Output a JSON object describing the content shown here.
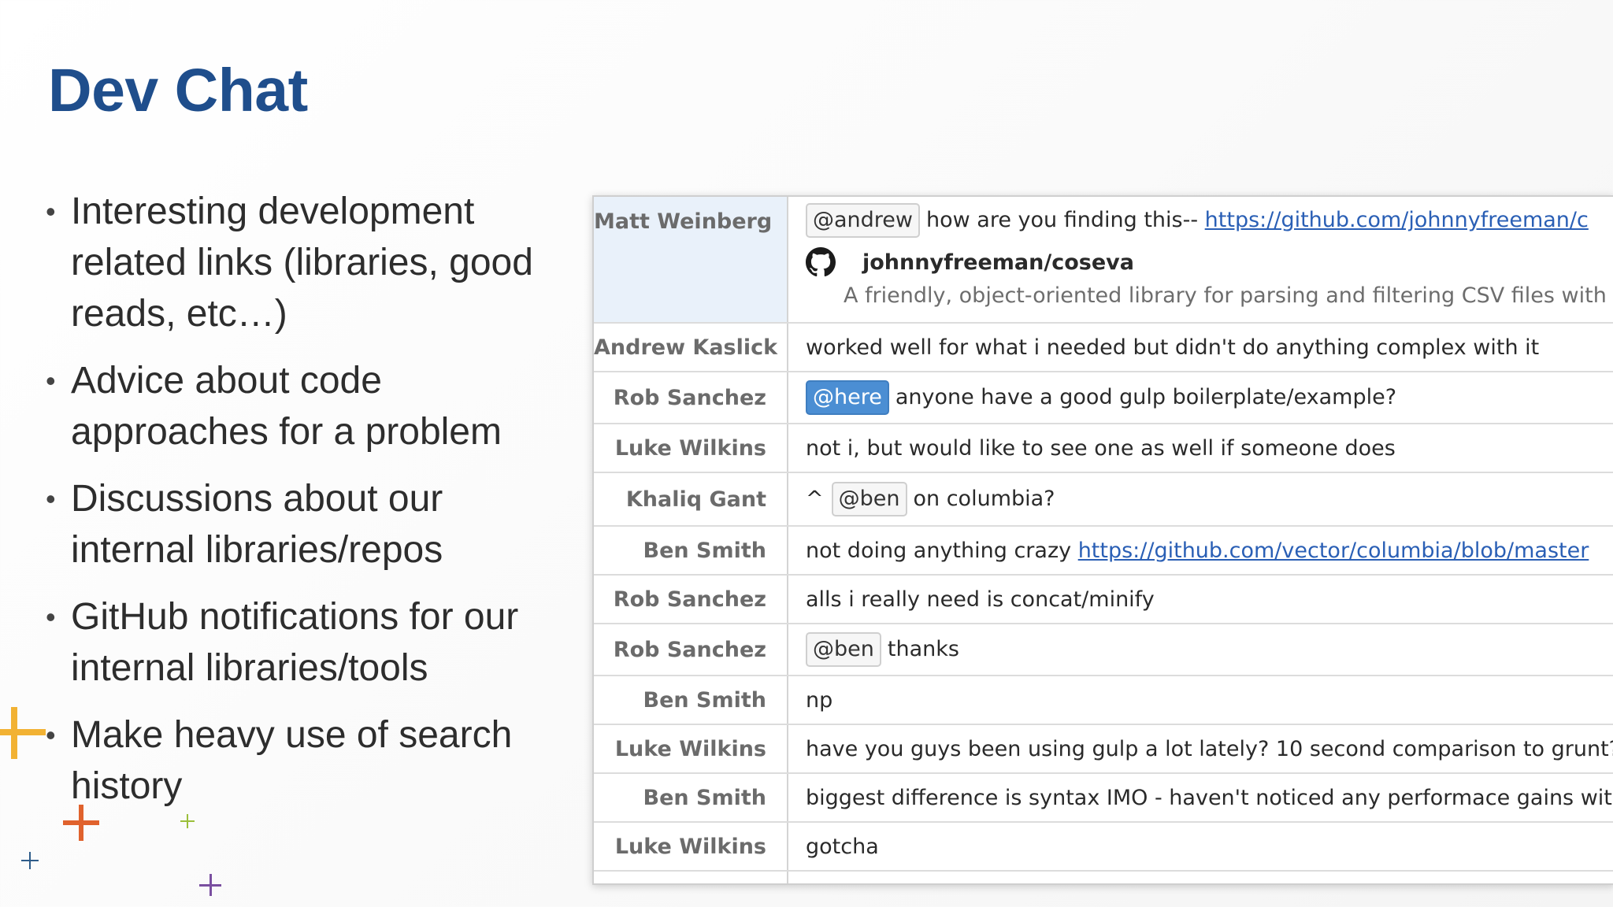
{
  "slide": {
    "title": "Dev Chat",
    "title_color": "#1f4e8c",
    "bullets": [
      "Interesting development related links (libraries, good reads, etc…)",
      "Advice about code approaches for a problem",
      "Discussions about our internal libraries/repos",
      "GitHub notifications for our internal libraries/tools",
      "Make heavy use of search history"
    ]
  },
  "decorations": {
    "plus_colors": [
      "#f2b233",
      "#e0622d",
      "#9bbf3b",
      "#2e5c8a",
      "#7a4fa0"
    ]
  },
  "chat": {
    "attachment": {
      "icon": "github-icon",
      "title": "johnnyfreeman/coseva",
      "description": "A friendly, object-oriented library for parsing and filtering CSV files with"
    },
    "rows": [
      {
        "author": "Matt Weinberg",
        "mention": "@andrew",
        "text": "how are you finding this-- ",
        "link": "https://github.com/johnnyfreeman/c"
      },
      {
        "author": "Andrew Kaslick",
        "text": "worked well for what i needed but didn't do anything complex with it"
      },
      {
        "author": "Rob Sanchez",
        "mention": "@here",
        "text": "anyone have a good gulp boilerplate/example?"
      },
      {
        "author": "Luke Wilkins",
        "text": "not i, but would like to see one as well if someone does"
      },
      {
        "author": "Khaliq Gant",
        "prefix": "^",
        "mention": "@ben",
        "text": "on columbia?"
      },
      {
        "author": "Ben Smith",
        "text": "not doing anything crazy ",
        "link": "https://github.com/vector/columbia/blob/master"
      },
      {
        "author": "Rob Sanchez",
        "text": "alls i really need is concat/minify"
      },
      {
        "author": "Rob Sanchez",
        "mention": "@ben",
        "text": "thanks"
      },
      {
        "author": "Ben Smith",
        "text": "np"
      },
      {
        "author": "Luke Wilkins",
        "text": "have you guys been using gulp a lot lately? 10 second comparison to grunt?"
      },
      {
        "author": "Ben Smith",
        "text": "biggest difference is syntax IMO - haven't noticed any performace gains wit"
      },
      {
        "author": "Luke Wilkins",
        "text": "gotcha"
      }
    ]
  }
}
